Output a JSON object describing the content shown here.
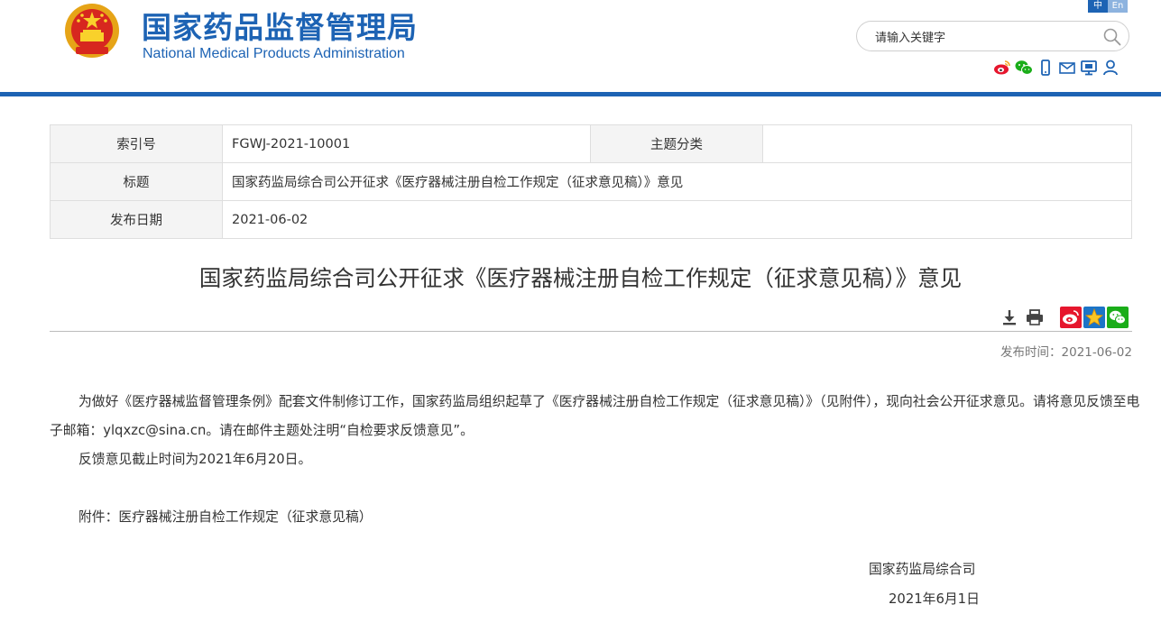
{
  "header": {
    "logo_cn": "国家药品监督管理局",
    "logo_en": "National Medical Products Administration",
    "lang_zh": "中",
    "lang_en": "En",
    "search_placeholder": "请输入关键字"
  },
  "info_table": {
    "index_label": "索引号",
    "index_value": "FGWJ-2021-10001",
    "category_label": "主题分类",
    "category_value": "",
    "title_label": "标题",
    "title_value": "国家药监局综合司公开征求《医疗器械注册自检工作规定（征求意见稿）》意见",
    "date_label": "发布日期",
    "date_value": "2021-06-02"
  },
  "article": {
    "title": "国家药监局综合司公开征求《医疗器械注册自检工作规定（征求意见稿）》意见",
    "publish_time": "发布时间：2021-06-02",
    "para1": "为做好《医疗器械监督管理条例》配套文件制修订工作，国家药监局组织起草了《医疗器械注册自检工作规定（征求意见稿）》（见附件），现向社会公开征求意见。请将意见反馈至电子邮箱：ylqxzc@sina.cn。请在邮件主题处注明“自检要求反馈意见”。",
    "para2": "反馈意见截止时间为2021年6月20日。",
    "attachment": "附件：医疗器械注册自检工作规定（征求意见稿）",
    "signature_org": "国家药监局综合司",
    "signature_date": "2021年6月1日"
  },
  "colors": {
    "brand_blue": "#1d63b4",
    "weibo_red": "#e6162d",
    "wechat_green": "#1aad19",
    "qzone_blue": "#1c74c7"
  },
  "icons": [
    "national-emblem-icon",
    "search-icon",
    "weibo-icon",
    "wechat-icon",
    "mobile-icon",
    "mail-icon",
    "monitor-icon",
    "user-icon",
    "download-icon",
    "print-icon",
    "share-weibo-icon",
    "share-qzone-icon",
    "share-wechat-icon"
  ]
}
